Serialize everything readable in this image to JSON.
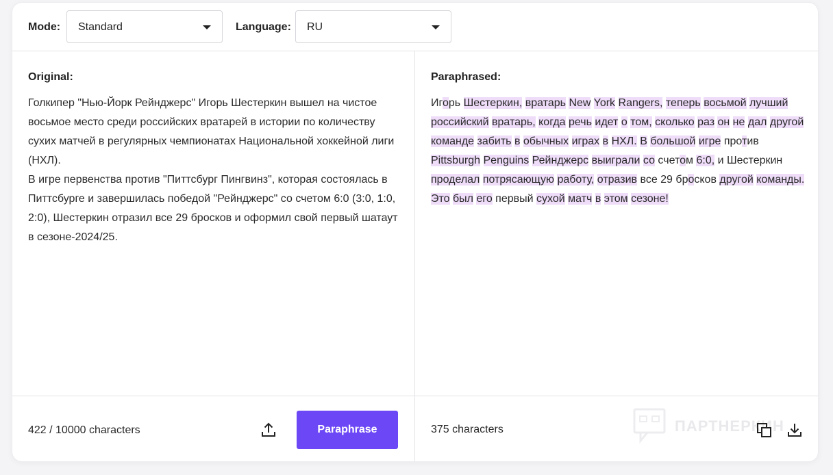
{
  "toolbar": {
    "mode_label": "Mode:",
    "mode_value": "Standard",
    "language_label": "Language:",
    "language_value": "RU"
  },
  "original": {
    "title": "Original:",
    "paragraphs": [
      "Голкипер \"Нью-Йорк Рейнджерс\" Игорь Шестеркин вышел на чистое восьмое место среди российских вратарей в истории по количеству сухих матчей в регулярных чемпионатах Национальной хоккейной лиги (НХЛ).",
      "В игре первенства против \"Питтсбург Пингвинз\", которая состоялась в Питтсбурге и завершилась победой \"Рейнджерс\" со счетом 6:0 (3:0, 1:0, 2:0), Шестеркин отразил все 29 бросков и оформил свой первый шатаут в сезоне-2024/25."
    ],
    "char_count": "422 / 10000 characters"
  },
  "paraphrased": {
    "title": "Paraphrased:",
    "segments": [
      {
        "t": "Иг",
        "h": false
      },
      {
        "t": "о",
        "h": true
      },
      {
        "t": "рь ",
        "h": false
      },
      {
        "t": "Шестеркин,",
        "h": true
      },
      {
        "t": " ",
        "h": false
      },
      {
        "t": "вратарь",
        "h": true
      },
      {
        "t": " ",
        "h": false
      },
      {
        "t": "New",
        "h": true
      },
      {
        "t": " ",
        "h": false
      },
      {
        "t": "York",
        "h": true
      },
      {
        "t": " ",
        "h": false
      },
      {
        "t": "Rangers,",
        "h": true
      },
      {
        "t": " ",
        "h": false
      },
      {
        "t": "теперь",
        "h": true
      },
      {
        "t": " ",
        "h": false
      },
      {
        "t": "восьмой",
        "h": true
      },
      {
        "t": " ",
        "h": false
      },
      {
        "t": "лучший",
        "h": true
      },
      {
        "t": " ",
        "h": false
      },
      {
        "t": "российский",
        "h": true
      },
      {
        "t": " ",
        "h": false
      },
      {
        "t": "вратарь,",
        "h": true
      },
      {
        "t": " ",
        "h": false
      },
      {
        "t": "когда",
        "h": true
      },
      {
        "t": " ",
        "h": false
      },
      {
        "t": "речь",
        "h": true
      },
      {
        "t": " ",
        "h": false
      },
      {
        "t": "идет",
        "h": true
      },
      {
        "t": " ",
        "h": false
      },
      {
        "t": "о",
        "h": true
      },
      {
        "t": " ",
        "h": false
      },
      {
        "t": "том,",
        "h": true
      },
      {
        "t": " ",
        "h": false
      },
      {
        "t": "сколько",
        "h": true
      },
      {
        "t": " ",
        "h": false
      },
      {
        "t": "раз",
        "h": true
      },
      {
        "t": " ",
        "h": false
      },
      {
        "t": "он",
        "h": true
      },
      {
        "t": " ",
        "h": false
      },
      {
        "t": "не",
        "h": true
      },
      {
        "t": " ",
        "h": false
      },
      {
        "t": "дал",
        "h": true
      },
      {
        "t": " ",
        "h": false
      },
      {
        "t": "другой",
        "h": true
      },
      {
        "t": " ",
        "h": false
      },
      {
        "t": "команде",
        "h": true
      },
      {
        "t": " ",
        "h": false
      },
      {
        "t": "забить",
        "h": true
      },
      {
        "t": " ",
        "h": false
      },
      {
        "t": "в",
        "h": true
      },
      {
        "t": " ",
        "h": false
      },
      {
        "t": "обычных",
        "h": true
      },
      {
        "t": " ",
        "h": false
      },
      {
        "t": "играх",
        "h": true
      },
      {
        "t": " ",
        "h": false
      },
      {
        "t": "в",
        "h": true
      },
      {
        "t": " ",
        "h": false
      },
      {
        "t": "НХЛ.",
        "h": true
      },
      {
        "t": " ",
        "h": false
      },
      {
        "t": "В",
        "h": true
      },
      {
        "t": " ",
        "h": false
      },
      {
        "t": "большой",
        "h": true
      },
      {
        "t": " ",
        "h": false
      },
      {
        "t": "игре",
        "h": true
      },
      {
        "t": " про",
        "h": false
      },
      {
        "t": "т",
        "h": true
      },
      {
        "t": "ив ",
        "h": false
      },
      {
        "t": "Pittsburgh",
        "h": true
      },
      {
        "t": " ",
        "h": false
      },
      {
        "t": "Penguins",
        "h": true
      },
      {
        "t": " ",
        "h": false
      },
      {
        "t": "Рейнджерс",
        "h": true
      },
      {
        "t": " ",
        "h": false
      },
      {
        "t": "выиграли",
        "h": true
      },
      {
        "t": " ",
        "h": false
      },
      {
        "t": "со",
        "h": true
      },
      {
        "t": " счет",
        "h": false
      },
      {
        "t": "о",
        "h": true
      },
      {
        "t": "м ",
        "h": false
      },
      {
        "t": "6:0,",
        "h": true
      },
      {
        "t": " и Шестеркин ",
        "h": false
      },
      {
        "t": "проделал",
        "h": true
      },
      {
        "t": " ",
        "h": false
      },
      {
        "t": "потрясающую",
        "h": true
      },
      {
        "t": " ",
        "h": false
      },
      {
        "t": "работу,",
        "h": true
      },
      {
        "t": " ",
        "h": false
      },
      {
        "t": "отразив",
        "h": true
      },
      {
        "t": " все 29 бр",
        "h": false
      },
      {
        "t": "о",
        "h": true
      },
      {
        "t": "сков ",
        "h": false
      },
      {
        "t": "другой",
        "h": true
      },
      {
        "t": " ",
        "h": false
      },
      {
        "t": "команды.",
        "h": true
      },
      {
        "t": " ",
        "h": false
      },
      {
        "t": "Это",
        "h": true
      },
      {
        "t": " ",
        "h": false
      },
      {
        "t": "был",
        "h": true
      },
      {
        "t": " ",
        "h": false
      },
      {
        "t": "его",
        "h": true
      },
      {
        "t": " первый ",
        "h": false
      },
      {
        "t": "сухой",
        "h": true
      },
      {
        "t": " ",
        "h": false
      },
      {
        "t": "матч",
        "h": true
      },
      {
        "t": " ",
        "h": false
      },
      {
        "t": "в",
        "h": true
      },
      {
        "t": " ",
        "h": false
      },
      {
        "t": "этом",
        "h": true
      },
      {
        "t": " ",
        "h": false
      },
      {
        "t": "сезоне!",
        "h": true
      }
    ],
    "char_count": "375 characters"
  },
  "actions": {
    "paraphrase_label": "Paraphrase",
    "upload_icon": "upload-icon",
    "copy_icon": "copy-icon",
    "download_icon": "download-icon"
  },
  "watermark": {
    "text": "ПАРТНЕРКИН"
  },
  "colors": {
    "accent": "#6c47f5",
    "highlight": "#eedcf9",
    "border": "#e3e3e8"
  }
}
